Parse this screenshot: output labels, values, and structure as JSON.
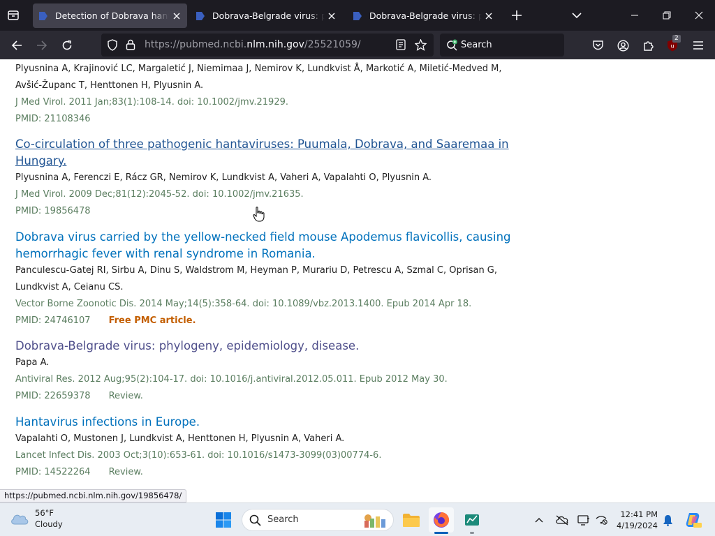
{
  "tabs": [
    {
      "title": "Detection of Dobrava hantavirus",
      "active": true
    },
    {
      "title": "Dobrava-Belgrade virus: phylogeny",
      "active": false
    },
    {
      "title": "Dobrava-Belgrade virus: phylogeny",
      "active": false
    }
  ],
  "navbar": {
    "url_prefix": "https://pubmed.ncbi.",
    "url_host": "nlm.nih.gov",
    "url_path": "/25521059/",
    "search_placeholder": "Search",
    "extension_badge": "2"
  },
  "articles": [
    {
      "title": "",
      "authors": "Plyusnina A, Krajinović LC, Margaletić J, Niemimaa J, Nemirov K, Lundkvist Å, Markotić A, Miletić-Medved M, Avšić-Županc T, Henttonen H, Plyusnin A.",
      "journal": "J Med Virol. 2011 Jan;83(1):108-14. doi: 10.1002/jmv.21929.",
      "pmid": "PMID: 21108346",
      "tag": "",
      "pmc": ""
    },
    {
      "title": "Co-circulation of three pathogenic hantaviruses: Puumala, Dobrava, and Saaremaa in Hungary.",
      "authors": "Plyusnina A, Ferenczi E, Rácz GR, Nemirov K, Lundkvist A, Vaheri A, Vapalahti O, Plyusnin A.",
      "journal": "J Med Virol. 2009 Dec;81(12):2045-52. doi: 10.1002/jmv.21635.",
      "pmid": "PMID: 19856478",
      "tag": "",
      "pmc": ""
    },
    {
      "title": "Dobrava virus carried by the yellow-necked field mouse Apodemus flavicollis, causing hemorrhagic fever with renal syndrome in Romania.",
      "authors": "Panculescu-Gatej RI, Sirbu A, Dinu S, Waldstrom M, Heyman P, Murariu D, Petrescu A, Szmal C, Oprisan G, Lundkvist A, Ceianu CS.",
      "journal": "Vector Borne Zoonotic Dis. 2014 May;14(5):358-64. doi: 10.1089/vbz.2013.1400. Epub 2014 Apr 18.",
      "pmid": "PMID: 24746107",
      "tag": "",
      "pmc": "Free PMC article."
    },
    {
      "title": "Dobrava-Belgrade virus: phylogeny, epidemiology, disease.",
      "authors": "Papa A.",
      "journal": "Antiviral Res. 2012 Aug;95(2):104-17. doi: 10.1016/j.antiviral.2012.05.011. Epub 2012 May 30.",
      "pmid": "PMID: 22659378",
      "tag": "Review.",
      "pmc": ""
    },
    {
      "title": "Hantavirus infections in Europe.",
      "authors": "Vapalahti O, Mustonen J, Lundkvist A, Henttonen H, Plyusnin A, Vaheri A.",
      "journal": "Lancet Infect Dis. 2003 Oct;3(10):653-61. doi: 10.1016/s1473-3099(03)00774-6.",
      "pmid": "PMID: 14522264",
      "tag": "Review.",
      "pmc": ""
    }
  ],
  "status_url": "https://pubmed.ncbi.nlm.nih.gov/19856478/",
  "taskbar": {
    "temperature": "56°F",
    "condition": "Cloudy",
    "search_placeholder": "Search",
    "time": "12:41 PM",
    "date": "4/19/2024"
  },
  "colors": {
    "link": "#0071bc",
    "visited_link": "#4f4f8b",
    "journal": "#5b7e60",
    "pmc_orange": "#c35e00"
  }
}
